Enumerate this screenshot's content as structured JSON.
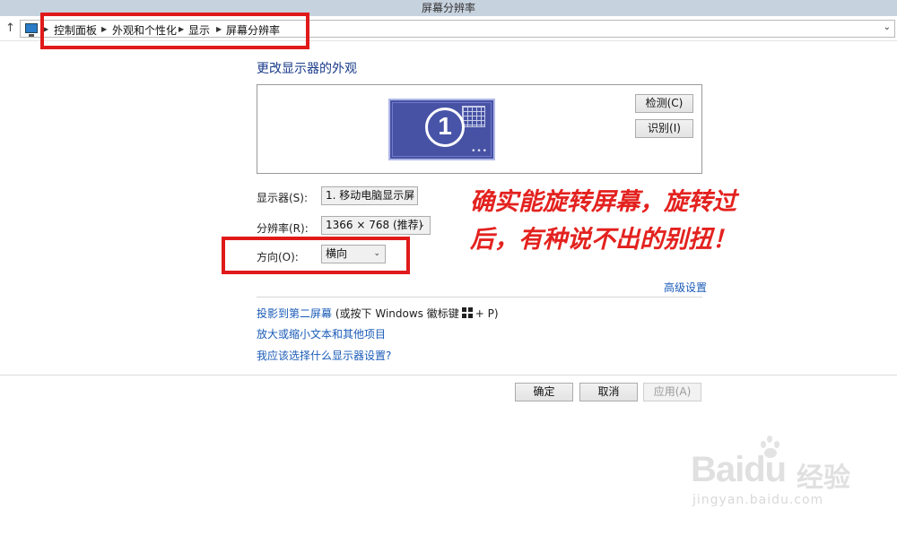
{
  "window": {
    "title": "屏幕分辨率"
  },
  "address": {
    "crumbs": [
      "控制面板",
      "外观和个性化",
      "显示",
      "屏幕分辨率"
    ]
  },
  "main": {
    "heading": "更改显示器的外观",
    "monitor_number": "1",
    "detect_label": "检测(C)",
    "identify_label": "识别(I)",
    "display_label": "显示器(S):",
    "display_value": "1. 移动电脑显示屏",
    "resolution_label": "分辨率(R):",
    "resolution_value": "1366 × 768 (推荐)",
    "orientation_label": "方向(O):",
    "orientation_value": "横向",
    "advanced_link": "高级设置",
    "project_link": "投影到第二屏幕",
    "project_hint_pre": "(或按下 Windows 徽标键",
    "project_hint_post": "+ P)",
    "text_size_link": "放大或缩小文本和其他项目",
    "which_settings_link": "我应该选择什么显示器设置?"
  },
  "buttons": {
    "ok": "确定",
    "cancel": "取消",
    "apply": "应用(A)"
  },
  "annotation": {
    "line1": "确实能旋转屏幕，旋转过",
    "line2": "后，有种说不出的别扭！"
  },
  "watermark": {
    "logo": "Baidu",
    "cn": "经验",
    "url": "jingyan.baidu.com"
  },
  "colors": {
    "highlight": "#e01a1a",
    "link": "#1a5bb8",
    "heading": "#1a3b8a",
    "monitor": "#4752a4"
  },
  "icons": [
    "up-arrow-icon",
    "computer-icon",
    "chevron-right-icon",
    "chevron-down-icon",
    "windows-logo-icon"
  ]
}
